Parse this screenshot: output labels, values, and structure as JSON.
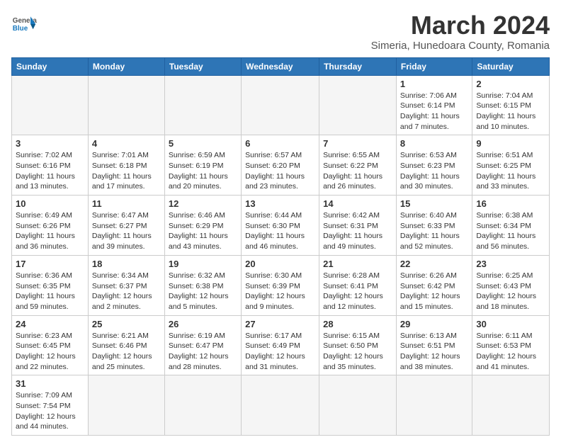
{
  "logo": {
    "text_general": "General",
    "text_blue": "Blue"
  },
  "title": "March 2024",
  "subtitle": "Simeria, Hunedoara County, Romania",
  "days_of_week": [
    "Sunday",
    "Monday",
    "Tuesday",
    "Wednesday",
    "Thursday",
    "Friday",
    "Saturday"
  ],
  "weeks": [
    [
      {
        "day": "",
        "info": ""
      },
      {
        "day": "",
        "info": ""
      },
      {
        "day": "",
        "info": ""
      },
      {
        "day": "",
        "info": ""
      },
      {
        "day": "",
        "info": ""
      },
      {
        "day": "1",
        "info": "Sunrise: 7:06 AM\nSunset: 6:14 PM\nDaylight: 11 hours\nand 7 minutes."
      },
      {
        "day": "2",
        "info": "Sunrise: 7:04 AM\nSunset: 6:15 PM\nDaylight: 11 hours\nand 10 minutes."
      }
    ],
    [
      {
        "day": "3",
        "info": "Sunrise: 7:02 AM\nSunset: 6:16 PM\nDaylight: 11 hours\nand 13 minutes."
      },
      {
        "day": "4",
        "info": "Sunrise: 7:01 AM\nSunset: 6:18 PM\nDaylight: 11 hours\nand 17 minutes."
      },
      {
        "day": "5",
        "info": "Sunrise: 6:59 AM\nSunset: 6:19 PM\nDaylight: 11 hours\nand 20 minutes."
      },
      {
        "day": "6",
        "info": "Sunrise: 6:57 AM\nSunset: 6:20 PM\nDaylight: 11 hours\nand 23 minutes."
      },
      {
        "day": "7",
        "info": "Sunrise: 6:55 AM\nSunset: 6:22 PM\nDaylight: 11 hours\nand 26 minutes."
      },
      {
        "day": "8",
        "info": "Sunrise: 6:53 AM\nSunset: 6:23 PM\nDaylight: 11 hours\nand 30 minutes."
      },
      {
        "day": "9",
        "info": "Sunrise: 6:51 AM\nSunset: 6:25 PM\nDaylight: 11 hours\nand 33 minutes."
      }
    ],
    [
      {
        "day": "10",
        "info": "Sunrise: 6:49 AM\nSunset: 6:26 PM\nDaylight: 11 hours\nand 36 minutes."
      },
      {
        "day": "11",
        "info": "Sunrise: 6:47 AM\nSunset: 6:27 PM\nDaylight: 11 hours\nand 39 minutes."
      },
      {
        "day": "12",
        "info": "Sunrise: 6:46 AM\nSunset: 6:29 PM\nDaylight: 11 hours\nand 43 minutes."
      },
      {
        "day": "13",
        "info": "Sunrise: 6:44 AM\nSunset: 6:30 PM\nDaylight: 11 hours\nand 46 minutes."
      },
      {
        "day": "14",
        "info": "Sunrise: 6:42 AM\nSunset: 6:31 PM\nDaylight: 11 hours\nand 49 minutes."
      },
      {
        "day": "15",
        "info": "Sunrise: 6:40 AM\nSunset: 6:33 PM\nDaylight: 11 hours\nand 52 minutes."
      },
      {
        "day": "16",
        "info": "Sunrise: 6:38 AM\nSunset: 6:34 PM\nDaylight: 11 hours\nand 56 minutes."
      }
    ],
    [
      {
        "day": "17",
        "info": "Sunrise: 6:36 AM\nSunset: 6:35 PM\nDaylight: 11 hours\nand 59 minutes."
      },
      {
        "day": "18",
        "info": "Sunrise: 6:34 AM\nSunset: 6:37 PM\nDaylight: 12 hours\nand 2 minutes."
      },
      {
        "day": "19",
        "info": "Sunrise: 6:32 AM\nSunset: 6:38 PM\nDaylight: 12 hours\nand 5 minutes."
      },
      {
        "day": "20",
        "info": "Sunrise: 6:30 AM\nSunset: 6:39 PM\nDaylight: 12 hours\nand 9 minutes."
      },
      {
        "day": "21",
        "info": "Sunrise: 6:28 AM\nSunset: 6:41 PM\nDaylight: 12 hours\nand 12 minutes."
      },
      {
        "day": "22",
        "info": "Sunrise: 6:26 AM\nSunset: 6:42 PM\nDaylight: 12 hours\nand 15 minutes."
      },
      {
        "day": "23",
        "info": "Sunrise: 6:25 AM\nSunset: 6:43 PM\nDaylight: 12 hours\nand 18 minutes."
      }
    ],
    [
      {
        "day": "24",
        "info": "Sunrise: 6:23 AM\nSunset: 6:45 PM\nDaylight: 12 hours\nand 22 minutes."
      },
      {
        "day": "25",
        "info": "Sunrise: 6:21 AM\nSunset: 6:46 PM\nDaylight: 12 hours\nand 25 minutes."
      },
      {
        "day": "26",
        "info": "Sunrise: 6:19 AM\nSunset: 6:47 PM\nDaylight: 12 hours\nand 28 minutes."
      },
      {
        "day": "27",
        "info": "Sunrise: 6:17 AM\nSunset: 6:49 PM\nDaylight: 12 hours\nand 31 minutes."
      },
      {
        "day": "28",
        "info": "Sunrise: 6:15 AM\nSunset: 6:50 PM\nDaylight: 12 hours\nand 35 minutes."
      },
      {
        "day": "29",
        "info": "Sunrise: 6:13 AM\nSunset: 6:51 PM\nDaylight: 12 hours\nand 38 minutes."
      },
      {
        "day": "30",
        "info": "Sunrise: 6:11 AM\nSunset: 6:53 PM\nDaylight: 12 hours\nand 41 minutes."
      }
    ],
    [
      {
        "day": "31",
        "info": "Sunrise: 7:09 AM\nSunset: 7:54 PM\nDaylight: 12 hours\nand 44 minutes."
      },
      {
        "day": "",
        "info": ""
      },
      {
        "day": "",
        "info": ""
      },
      {
        "day": "",
        "info": ""
      },
      {
        "day": "",
        "info": ""
      },
      {
        "day": "",
        "info": ""
      },
      {
        "day": "",
        "info": ""
      }
    ]
  ]
}
